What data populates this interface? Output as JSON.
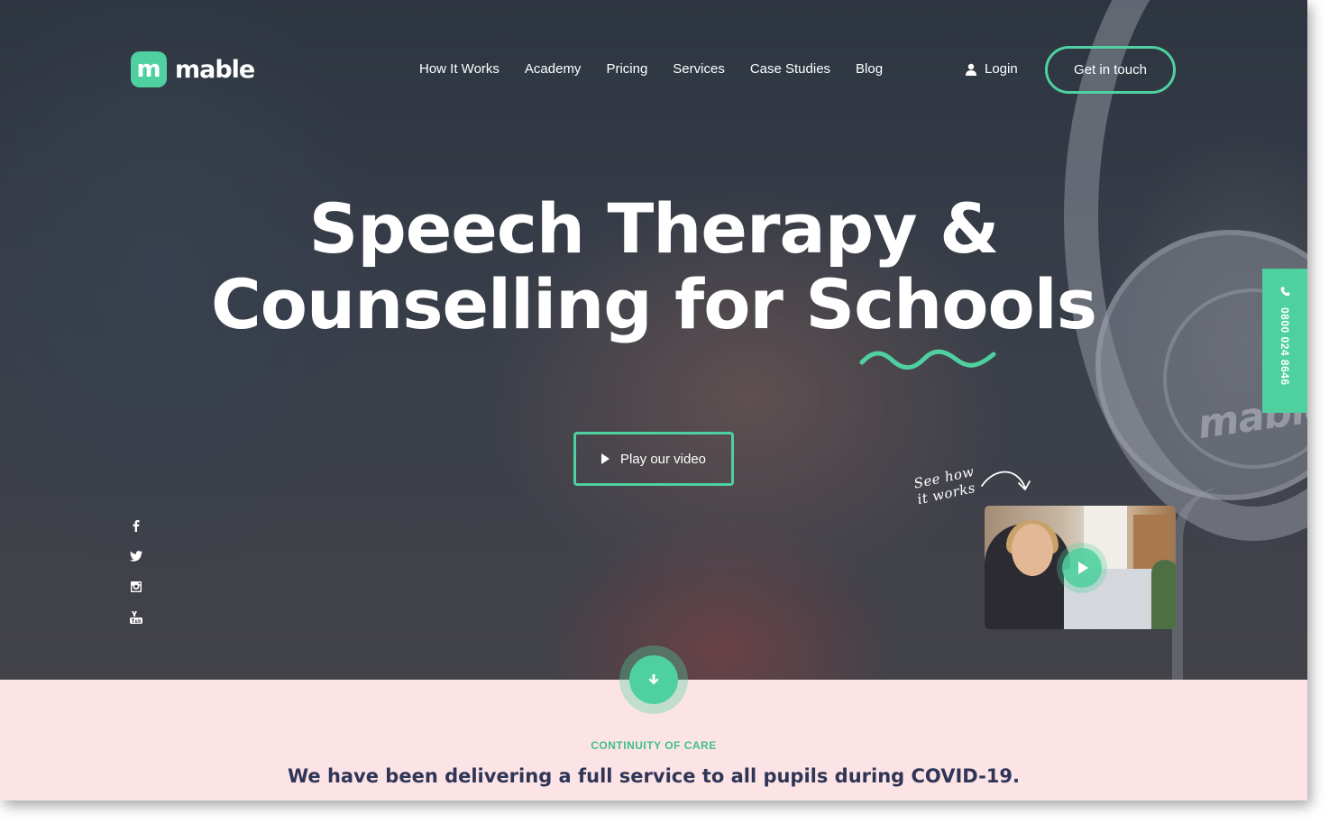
{
  "brand": {
    "logo_mark": "m",
    "name": "mable",
    "accent_color": "#4fd0a0"
  },
  "nav": {
    "items": [
      {
        "label": "How It Works"
      },
      {
        "label": "Academy"
      },
      {
        "label": "Pricing"
      },
      {
        "label": "Services"
      },
      {
        "label": "Case Studies"
      },
      {
        "label": "Blog"
      }
    ],
    "login_label": "Login",
    "login_icon": "user-icon",
    "cta_label": "Get in touch"
  },
  "hero": {
    "title_line1": "Speech Therapy &",
    "title_line2": "Counselling for Schools",
    "play_button_label": "Play our video",
    "see_how_line1": "See how",
    "see_how_line2": "it works",
    "headphones_brand": "mable"
  },
  "social": {
    "icons": [
      "facebook-icon",
      "twitter-icon",
      "instagram-icon",
      "youtube-icon"
    ]
  },
  "phone_tab": {
    "icon": "phone-icon",
    "number": "0800 024 8646"
  },
  "section": {
    "eyebrow": "CONTINUITY OF CARE",
    "heading": "We have been delivering a full service to all pupils during COVID-19."
  }
}
